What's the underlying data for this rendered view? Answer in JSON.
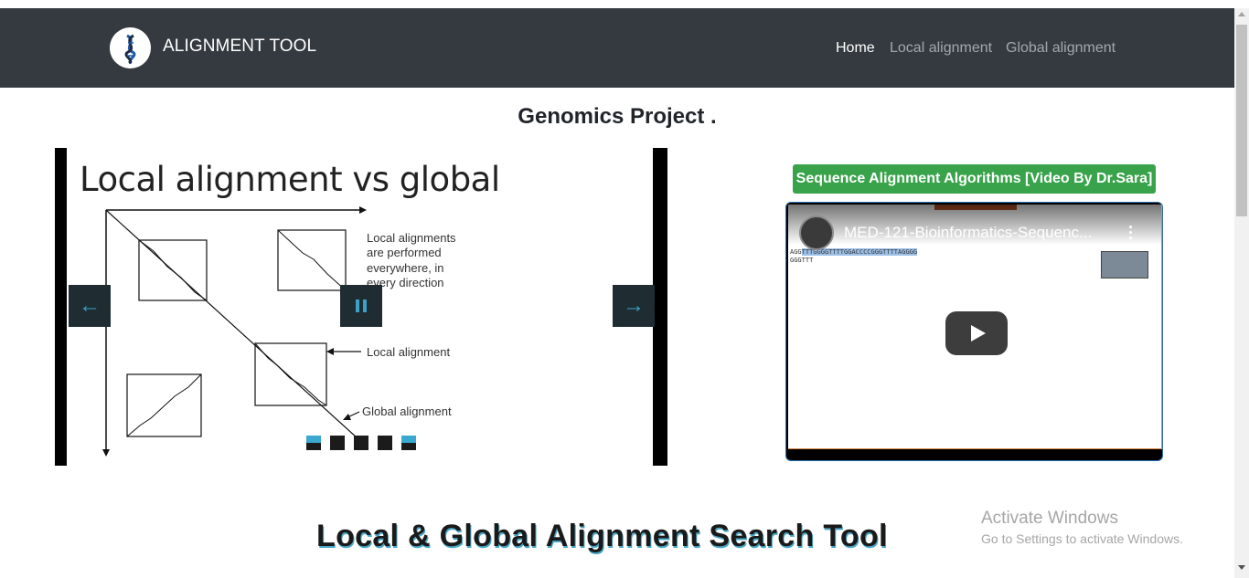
{
  "navbar": {
    "brand": "ALIGNMENT TOOL",
    "links": [
      {
        "label": "Home",
        "active": true
      },
      {
        "label": "Local alignment",
        "active": false
      },
      {
        "label": "Global alignment",
        "active": false
      }
    ]
  },
  "main": {
    "project_title": "Genomics Project ."
  },
  "carousel": {
    "slide_title": "Local alignment vs global",
    "slide_labels": {
      "local_desc_1": "Local alignments",
      "local_desc_2": "are performed",
      "local_desc_3": "everywhere, in",
      "local_desc_4": "every direction",
      "local_alignment": "Local alignment",
      "global_alignment": "Global alignment"
    },
    "indicator_count": 5,
    "active_indicators": [
      0,
      4
    ]
  },
  "video": {
    "button_label": "Sequence Alignment Algorithms [Video By Dr.Sara]",
    "title": "MED-121-Bioinformatics-Sequenc...",
    "seq_line_1_pre": "AGG",
    "seq_line_1_hl": "TTTGGGGTTTTGGACCCCGGGTTTTAGGGG",
    "seq_line_2": "GGGTTT"
  },
  "footer": {
    "search_heading": "Local & Global Alignment Search Tool"
  },
  "watermark": {
    "title": "Activate Windows",
    "subtitle": "Go to Settings to activate Windows."
  },
  "colors": {
    "navbar_bg": "#343a40",
    "video_button_bg": "#38a34a",
    "carousel_control_bg": "#1f2d33",
    "carousel_accent": "#39a2c6"
  }
}
